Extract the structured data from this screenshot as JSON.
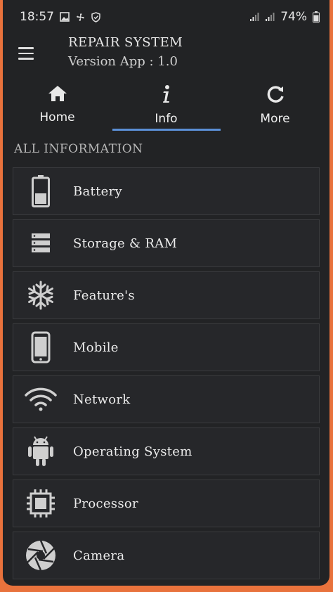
{
  "status_bar": {
    "time": "18:57",
    "battery": "74%",
    "icons": [
      "image-icon",
      "fan-icon",
      "shield-icon",
      "signal-icon",
      "signal-icon",
      "battery-icon"
    ]
  },
  "app_bar": {
    "title": "REPAIR SYSTEM",
    "subtitle": "Version App : 1.0"
  },
  "tabs": [
    {
      "label": "Home",
      "icon": "home-icon"
    },
    {
      "label": "Info",
      "icon": "info-icon",
      "selected": true
    },
    {
      "label": "More",
      "icon": "refresh-icon"
    }
  ],
  "section": {
    "title": "ALL INFORMATION"
  },
  "items": [
    {
      "label": "Battery",
      "icon": "battery-icon"
    },
    {
      "label": "Storage & RAM",
      "icon": "storage-icon"
    },
    {
      "label": "Feature's",
      "icon": "snowflake-icon"
    },
    {
      "label": "Mobile",
      "icon": "phone-icon"
    },
    {
      "label": "Network",
      "icon": "wifi-icon"
    },
    {
      "label": "Operating System",
      "icon": "android-icon"
    },
    {
      "label": "Processor",
      "icon": "chip-icon"
    },
    {
      "label": "Camera",
      "icon": "aperture-icon"
    }
  ],
  "colors": {
    "background": "#222325",
    "accent": "#5b8fd6",
    "frame": "#e8723c"
  }
}
